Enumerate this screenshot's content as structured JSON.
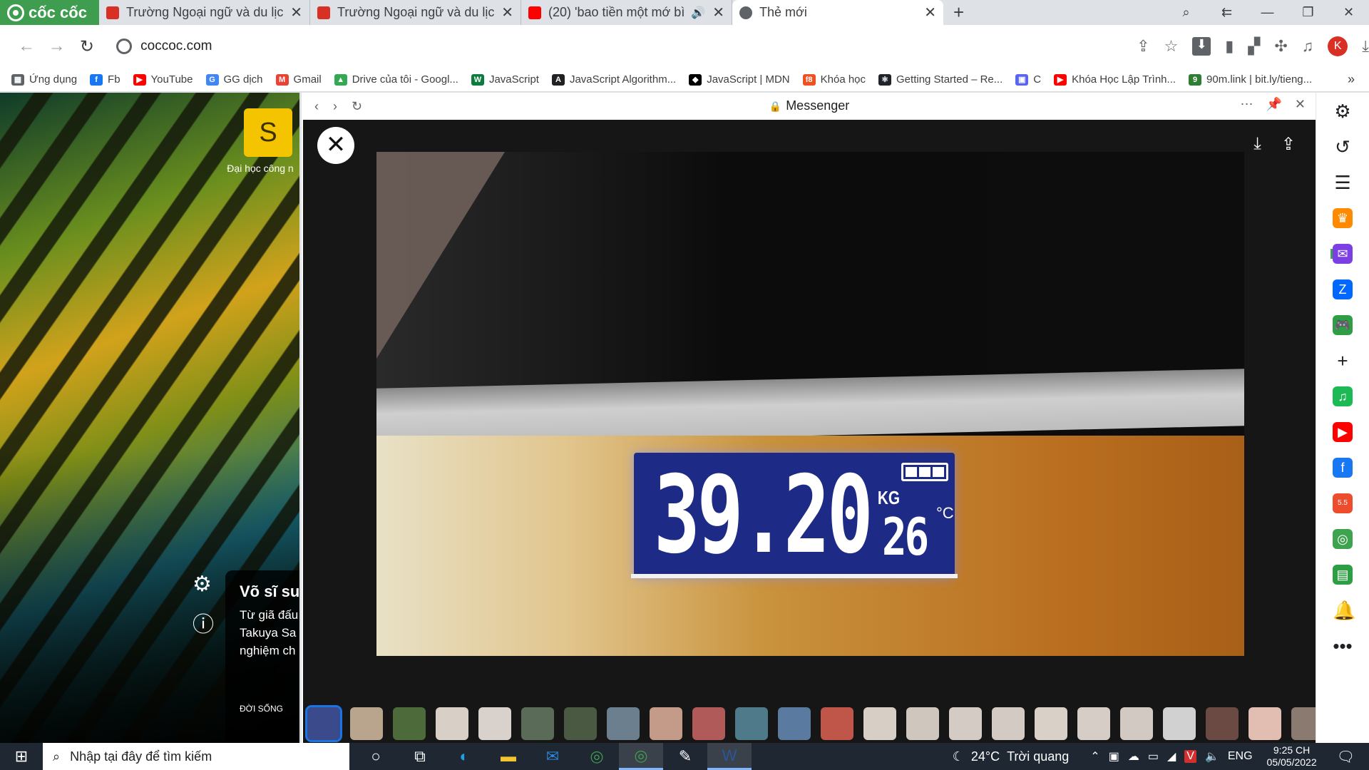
{
  "browser": {
    "brand": "cốc cốc",
    "tabs": [
      {
        "title": "Trường Ngoại ngữ và du lịch",
        "favicon_color": "#d93025",
        "active": false,
        "audio": false
      },
      {
        "title": "Trường Ngoại ngữ và du lịch",
        "favicon_color": "#d93025",
        "active": false,
        "audio": false
      },
      {
        "title": "(20) 'bao tiền một mớ bìn",
        "favicon_color": "#ff0000",
        "active": false,
        "audio": true
      },
      {
        "title": "Thẻ mới",
        "favicon_color": "#5f6368",
        "active": true,
        "audio": false
      }
    ],
    "new_tab": "+",
    "url": "coccoc.com",
    "bookmarks": [
      {
        "label": "Ứng dụng",
        "color": "#5f6368",
        "glyph": "▦"
      },
      {
        "label": "Fb",
        "color": "#1877f2",
        "glyph": "f"
      },
      {
        "label": "YouTube",
        "color": "#ff0000",
        "glyph": "▶"
      },
      {
        "label": "GG dịch",
        "color": "#4285f4",
        "glyph": "G"
      },
      {
        "label": "Gmail",
        "color": "#ea4335",
        "glyph": "M"
      },
      {
        "label": "Drive của tôi - Googl...",
        "color": "#34a853",
        "glyph": "▲"
      },
      {
        "label": "JavaScript",
        "color": "#0a7d3e",
        "glyph": "W"
      },
      {
        "label": "JavaScript Algorithm...",
        "color": "#202124",
        "glyph": "A"
      },
      {
        "label": "JavaScript | MDN",
        "color": "#000000",
        "glyph": "◆"
      },
      {
        "label": "Khóa học",
        "color": "#f05123",
        "glyph": "f8"
      },
      {
        "label": "Getting Started – Re...",
        "color": "#20232a",
        "glyph": "⚛"
      },
      {
        "label": "C",
        "color": "#5865f2",
        "glyph": "▣"
      },
      {
        "label": "Khóa Học Lập Trình...",
        "color": "#ff0000",
        "glyph": "▶"
      },
      {
        "label": "90m.link | bit.ly/tieng...",
        "color": "#2e7d32",
        "glyph": "9"
      }
    ],
    "bookmarks_more": "»"
  },
  "newtab": {
    "shortcut": {
      "letter": "S",
      "label": "Đại học công n"
    },
    "news": {
      "headline": "Võ sĩ su nghệ",
      "summary_lines": [
        "Từ giã đấu",
        "Takuya Sa",
        "nghiệm ch"
      ],
      "tag": "ĐỜI SỐNG"
    }
  },
  "messenger": {
    "title": "Messenger",
    "photo_readout": {
      "weight": "39.20",
      "unit": "KG",
      "temperature": "26",
      "temp_unit": "°C"
    },
    "thumbnails": [
      "#3a4a8a",
      "#b9a58e",
      "#4d6b3a",
      "#d8cfc6",
      "#d9d2cc",
      "#5a6b58",
      "#4a5a42",
      "#6b7f8e",
      "#c49a88",
      "#b05a5a",
      "#4f7a8a",
      "#5a7aa0",
      "#c0564a",
      "#d7cfc6",
      "#cfc7be",
      "#d4ccc4",
      "#d3cbc3",
      "#d9d0c7",
      "#d6cec6",
      "#d2cac2",
      "#d1d1d1",
      "#6b4a44",
      "#e1bdb2",
      "#8a7a70"
    ]
  },
  "sidebar_icons": [
    {
      "name": "settings-icon",
      "glyph": "⚙",
      "color": ""
    },
    {
      "name": "history-icon",
      "glyph": "↺",
      "color": ""
    },
    {
      "name": "reading-list-icon",
      "glyph": "☰",
      "color": ""
    },
    {
      "name": "crown-icon",
      "glyph": "♛",
      "color": "#ff8a00"
    },
    {
      "name": "messenger-icon",
      "glyph": "✉",
      "color": "#7b3fe4"
    },
    {
      "name": "zalo-icon",
      "glyph": "Z",
      "color": "#0068ff"
    },
    {
      "name": "game-icon",
      "glyph": "🎮",
      "color": "#2e9e44"
    },
    {
      "name": "add-icon",
      "glyph": "+",
      "color": ""
    },
    {
      "name": "spotify-icon",
      "glyph": "♫",
      "color": "#1db954"
    },
    {
      "name": "youtube-icon",
      "glyph": "▶",
      "color": "#ff0000"
    },
    {
      "name": "facebook-icon",
      "glyph": "f",
      "color": "#1877f2"
    },
    {
      "name": "shopee-icon",
      "glyph": "5.5",
      "color": "#ee4d2d"
    },
    {
      "name": "lens-icon",
      "glyph": "◎",
      "color": "#3ea34f"
    },
    {
      "name": "calculator-icon",
      "glyph": "▤",
      "color": "#2e9e44"
    },
    {
      "name": "bell-icon",
      "glyph": "🔔",
      "color": ""
    },
    {
      "name": "more-icon",
      "glyph": "•••",
      "color": ""
    }
  ],
  "taskbar": {
    "search_placeholder": "Nhập tại đây để tìm kiếm",
    "apps": [
      {
        "name": "cortana-icon",
        "glyph": "○",
        "color": "",
        "running": false
      },
      {
        "name": "task-view-icon",
        "glyph": "⧉",
        "color": "",
        "running": false
      },
      {
        "name": "edge-icon",
        "glyph": "◐",
        "color": "#1fa0e3",
        "running": false
      },
      {
        "name": "file-explorer-icon",
        "glyph": "▬",
        "color": "#f4c430",
        "running": false
      },
      {
        "name": "mail-icon",
        "glyph": "✉",
        "color": "#2b88d8",
        "running": false
      },
      {
        "name": "coccoc-app-icon",
        "glyph": "◎",
        "color": "#3e9d4f",
        "running": false
      },
      {
        "name": "coccoc-profile-icon",
        "glyph": "◎",
        "color": "#3e9d4f",
        "running": true
      },
      {
        "name": "paint-icon",
        "glyph": "✎",
        "color": "#ffffff",
        "running": false
      },
      {
        "name": "word-icon",
        "glyph": "W",
        "color": "#2b579a",
        "running": true
      }
    ],
    "weather": {
      "temp": "24°C",
      "desc": "Trời quang"
    },
    "language": "ENG",
    "time": "9:25 CH",
    "date": "05/05/2022"
  }
}
